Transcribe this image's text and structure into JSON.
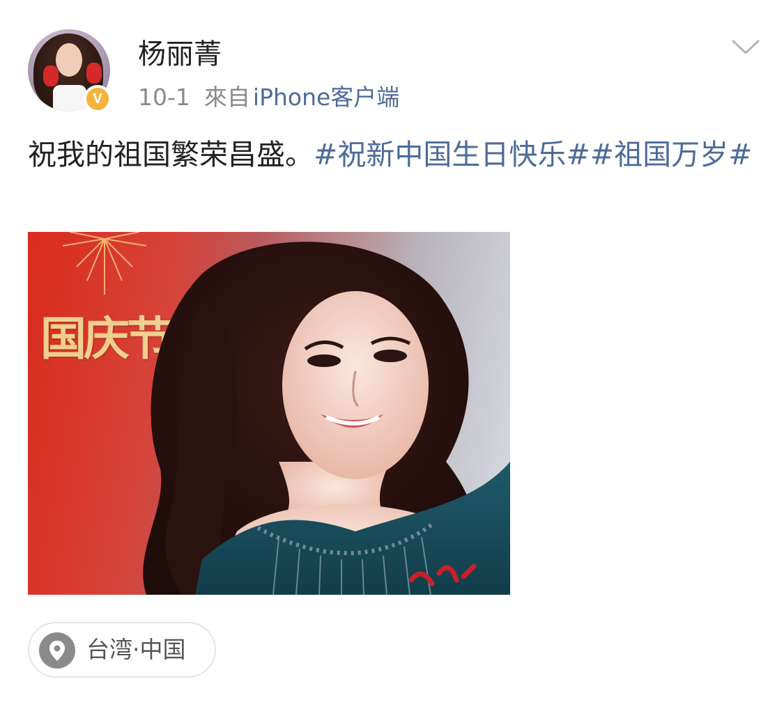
{
  "user": {
    "name": "杨丽菁",
    "verified": true,
    "verified_badge_glyph": "V",
    "avatar_icon": "avatar-photo",
    "badge_color": "#f4b43a"
  },
  "meta": {
    "date": "10-1",
    "from_label": "來自",
    "source": "iPhone客户端"
  },
  "menu": {
    "icon": "chevron-down-icon"
  },
  "post": {
    "text": "祝我的祖国繁荣昌盛。",
    "topics": [
      "#祝新中国生日快乐#",
      "#祖国万岁#"
    ],
    "link_color": "#4d6b9a"
  },
  "image": {
    "overlay_text": "国庆节",
    "description_icon": "photo-image"
  },
  "location": {
    "icon": "location-pin-icon",
    "label": "台湾·中国"
  }
}
